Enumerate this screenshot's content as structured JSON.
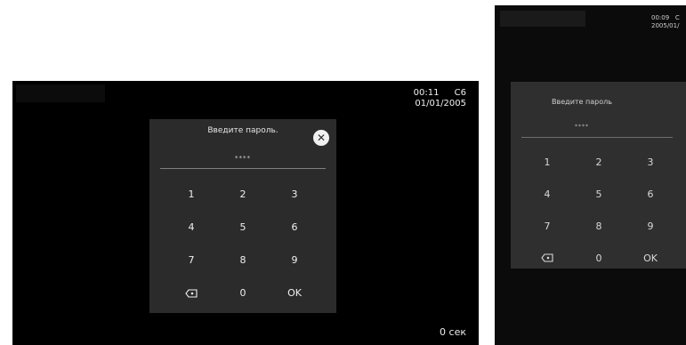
{
  "main_screen": {
    "status": {
      "time": "00:11",
      "channel": "C6",
      "date": "01/01/2005"
    },
    "dialog": {
      "title": "Введите пароль.",
      "password_mask": "****",
      "keys": [
        {
          "label": "1",
          "name": "key-1"
        },
        {
          "label": "2",
          "name": "key-2"
        },
        {
          "label": "3",
          "name": "key-3"
        },
        {
          "label": "4",
          "name": "key-4"
        },
        {
          "label": "5",
          "name": "key-5"
        },
        {
          "label": "6",
          "name": "key-6"
        },
        {
          "label": "7",
          "name": "key-7"
        },
        {
          "label": "8",
          "name": "key-8"
        },
        {
          "label": "9",
          "name": "key-9"
        },
        {
          "label": "",
          "name": "backspace-button",
          "icon": "backspace-icon"
        },
        {
          "label": "0",
          "name": "key-0"
        },
        {
          "label": "OK",
          "name": "ok-button"
        }
      ]
    },
    "timer": "0 сек"
  },
  "photo_screen": {
    "status": {
      "time": "00:09",
      "channel": "C",
      "date": "2005/01/"
    },
    "dialog": {
      "title": "Введите пароль",
      "password_mask": "****",
      "keys": [
        {
          "label": "1"
        },
        {
          "label": "2"
        },
        {
          "label": "3"
        },
        {
          "label": "4"
        },
        {
          "label": "5"
        },
        {
          "label": "6"
        },
        {
          "label": "7"
        },
        {
          "label": "8"
        },
        {
          "label": "9"
        },
        {
          "label": "",
          "icon": "backspace-icon"
        },
        {
          "label": "0"
        },
        {
          "label": "OK"
        }
      ]
    }
  }
}
